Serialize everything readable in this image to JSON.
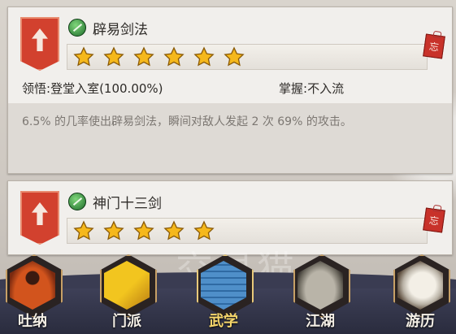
{
  "skills": [
    {
      "name": "辟易剑法",
      "star_count": 6,
      "comprehension_label": "领悟:",
      "comprehension_value": "登堂入室(100.00%)",
      "mastery_label": "掌握:",
      "mastery_value": "不入流",
      "description": "6.5% 的几率使出辟易剑法，瞬间对敌人发起 2 次 69% 的攻击。",
      "memo_glyph": "忘"
    },
    {
      "name": "神门十三剑",
      "star_count": 5,
      "memo_glyph": "忘"
    }
  ],
  "bottom_nav": [
    {
      "label": "吐纳",
      "icon": "monk-meditation-icon",
      "active": false
    },
    {
      "label": "门派",
      "icon": "sect-flag-icon",
      "active": false
    },
    {
      "label": "武学",
      "icon": "martial-manual-book-icon",
      "active": true
    },
    {
      "label": "江湖",
      "icon": "bamboo-hat-icon",
      "active": false
    },
    {
      "label": "游历",
      "icon": "white-horse-icon",
      "active": false
    }
  ],
  "watermark": "交易猫",
  "colors": {
    "banner_red": "#d2412e",
    "star_gold": "#f5b81c",
    "nav_active": "#f6d66b",
    "card_bg": "#f1efec"
  }
}
